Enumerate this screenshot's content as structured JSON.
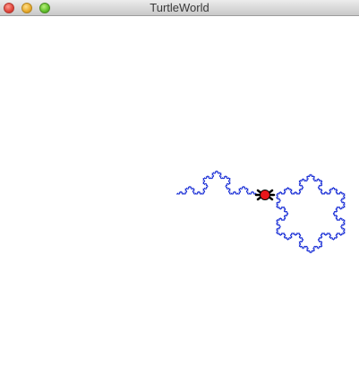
{
  "window": {
    "title": "TurtleWorld"
  },
  "canvas": {
    "background": "#ffffff",
    "trail_color": "#1a2fd6",
    "turtle_body_color": "#e8161a",
    "turtle_outline_color": "#000000"
  }
}
